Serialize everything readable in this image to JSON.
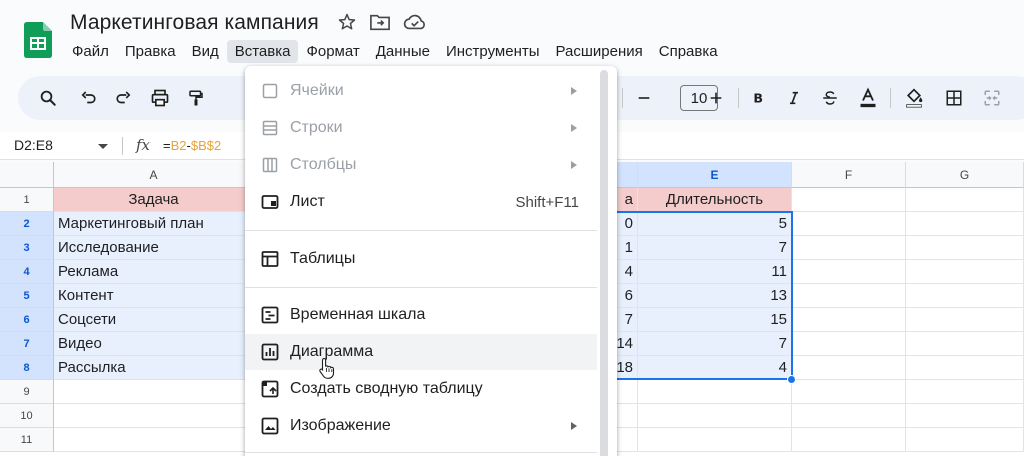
{
  "app": {
    "doc_title": "Маркетинговая кампания",
    "brand_color": "#0f9d58"
  },
  "menubar": {
    "items": [
      "Файл",
      "Правка",
      "Вид",
      "Вставка",
      "Формат",
      "Данные",
      "Инструменты",
      "Расширения",
      "Справка"
    ],
    "active": "Вставка"
  },
  "toolbar": {
    "zoom_partial": "10",
    "font_size": "10",
    "icons": [
      "search-icon",
      "undo-icon",
      "redo-icon",
      "print-icon",
      "paint-format-icon",
      "decrease-font-icon",
      "increase-font-icon",
      "bold-icon",
      "italic-icon",
      "strikethrough-icon",
      "text-color-icon",
      "fill-color-icon",
      "borders-icon",
      "merge-cells-icon"
    ]
  },
  "formula_bar": {
    "name_box": "D2:E8",
    "fx": "fx",
    "formula_eq": "=",
    "formula_ref1": "B2",
    "formula_minus": "-",
    "formula_ref2": "$B$2"
  },
  "grid": {
    "columns": [
      "A",
      "E",
      "F",
      "G"
    ],
    "rows": [
      "1",
      "2",
      "3",
      "4",
      "5",
      "6",
      "7",
      "8",
      "9",
      "10",
      "11"
    ],
    "header_a": "Задача",
    "header_d_partial": "а",
    "header_e": "Длительность",
    "tasks": [
      "Маркетинговый план",
      "Исследование",
      "Реклама",
      "Контент",
      "Соцсети",
      "Видео",
      "Рассылка"
    ],
    "col_d_values": [
      "0",
      "1",
      "4",
      "6",
      "7",
      "14",
      "18"
    ],
    "durations": [
      "5",
      "7",
      "11",
      "13",
      "15",
      "7",
      "4"
    ]
  },
  "dropdown": {
    "items": [
      {
        "label": "Ячейки",
        "icon": "cell-checkbox-icon",
        "disabled": true,
        "submenu": true
      },
      {
        "label": "Строки",
        "icon": "rows-icon",
        "disabled": true,
        "submenu": true
      },
      {
        "label": "Столбцы",
        "icon": "columns-icon",
        "disabled": true,
        "submenu": true
      },
      {
        "label": "Лист",
        "icon": "sheet-icon",
        "shortcut": "Shift+F11"
      },
      {
        "label": "Таблицы",
        "icon": "table-icon"
      },
      {
        "label": "Временная шкала",
        "icon": "timeline-icon"
      },
      {
        "label": "Диаграмма",
        "icon": "chart-icon",
        "hover": true
      },
      {
        "label": "Создать сводную таблицу",
        "icon": "pivot-table-icon"
      },
      {
        "label": "Изображение",
        "icon": "image-icon",
        "submenu": true
      }
    ]
  },
  "colors": {
    "header_fill": "#f4cccc",
    "selection_fill": "#e8f0fe",
    "selection_border": "#1a73e8",
    "toolbar_bg": "#edf2fa"
  }
}
